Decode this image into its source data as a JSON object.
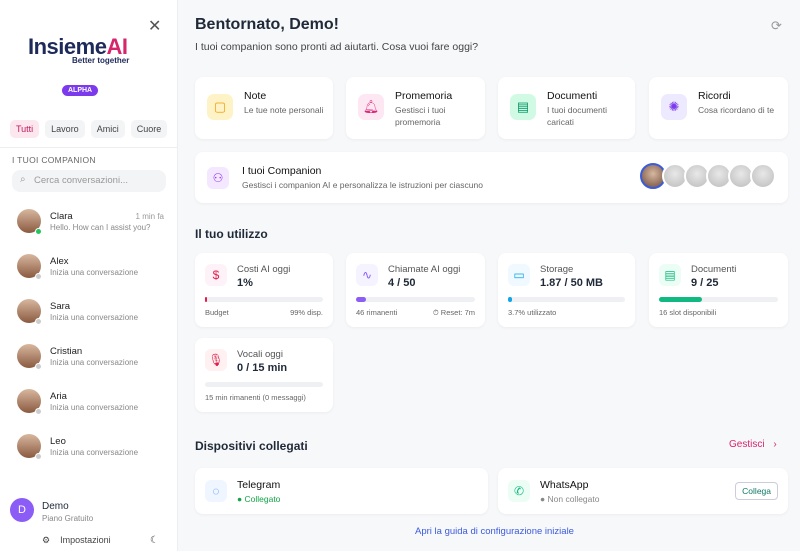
{
  "sidebar": {
    "logo": "InsiemeAI",
    "logo_a": "Insieme",
    "logo_b": "AI",
    "tagline": "Better together",
    "badge": "ALPHA",
    "filters": [
      "Tutti",
      "Lavoro",
      "Amici",
      "Cuore"
    ],
    "section": "I TUOI COMPANION",
    "search_placeholder": "Cerca conversazioni...",
    "companions": [
      {
        "name": "Clara",
        "sub": "Hello. How can I assist you?",
        "time": "1 min fa",
        "online": true
      },
      {
        "name": "Alex",
        "sub": "Inizia una conversazione"
      },
      {
        "name": "Sara",
        "sub": "Inizia una conversazione"
      },
      {
        "name": "Cristian",
        "sub": "Inizia una conversazione"
      },
      {
        "name": "Aria",
        "sub": "Inizia una conversazione"
      },
      {
        "name": "Leo",
        "sub": "Inizia una conversazione"
      }
    ],
    "user": {
      "initial": "D",
      "name": "Demo",
      "plan": "Piano Gratuito"
    },
    "settings": "Impostazioni"
  },
  "main": {
    "title": "Bentornato, Demo!",
    "subtitle": "I tuoi companion sono pronti ad aiutarti. Cosa vuoi fare oggi?",
    "quick": [
      {
        "title": "Note",
        "sub": "Le tue note personali",
        "icon": "note-icon",
        "color": "#f59e0b",
        "bg": "#fef3c7"
      },
      {
        "title": "Promemoria",
        "sub": "Gestisci i tuoi promemoria",
        "icon": "bell-icon",
        "color": "#db2777",
        "bg": "#fce7f3"
      },
      {
        "title": "Documenti",
        "sub": "I tuoi documenti caricati",
        "icon": "document-icon",
        "color": "#059669",
        "bg": "#d1fae5"
      },
      {
        "title": "Ricordi",
        "sub": "Cosa ricordano di te",
        "icon": "brain-icon",
        "color": "#7c3aed",
        "bg": "#ede9fe"
      }
    ],
    "companions_card": {
      "title": "I tuoi Companion",
      "sub": "Gestisci i companion AI e personalizza le istruzioni per ciascuno"
    },
    "usage_title": "Il tuo utilizzo",
    "usage": [
      {
        "label": "Costi AI oggi",
        "value": "1%",
        "left": "Budget",
        "right": "99% disp.",
        "percent": 1,
        "color": "#e11d48",
        "bg": "#fdf2f8",
        "icon": "dollar-icon"
      },
      {
        "label": "Chiamate AI oggi",
        "value": "4 / 50",
        "left": "46 rimanenti",
        "right": "⏱ Reset: 7m",
        "percent": 8,
        "color": "#8b5cf6",
        "bg": "#f5f3ff",
        "icon": "activity-icon"
      },
      {
        "label": "Storage",
        "value": "1.87 / 50 MB",
        "left": "3.7% utilizzato",
        "right": "",
        "percent": 3.7,
        "color": "#0ea5e9",
        "bg": "#f0f9ff",
        "icon": "storage-icon"
      },
      {
        "label": "Documenti",
        "value": "9 / 25",
        "left": "16 slot disponibili",
        "right": "",
        "percent": 36,
        "color": "#10b981",
        "bg": "#ecfdf5",
        "icon": "document-icon"
      },
      {
        "label": "Vocali oggi",
        "value": "0 / 15 min",
        "left": "15 min rimanenti (0 messaggi)",
        "right": "",
        "percent": 0,
        "color": "#e11d48",
        "bg": "#fff1f2",
        "icon": "mic-icon"
      }
    ],
    "devices_title": "Dispositivi collegati",
    "manage": "Gestisci",
    "devices": [
      {
        "name": "Telegram",
        "status": "Collegato",
        "connected": true
      },
      {
        "name": "WhatsApp",
        "status": "Non collegato",
        "connected": false,
        "button": "Collega"
      }
    ],
    "guide": "Apri la guida di configurazione iniziale"
  }
}
